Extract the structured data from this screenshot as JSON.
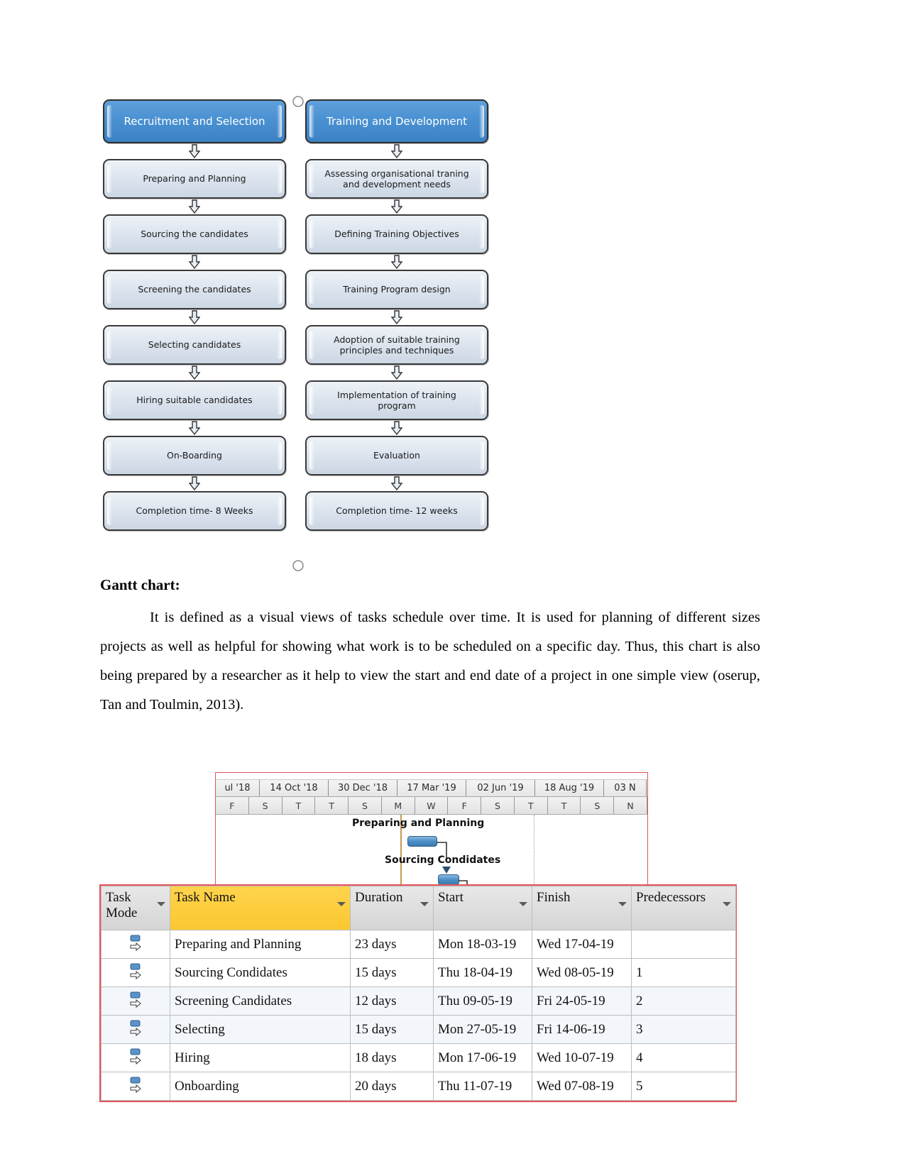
{
  "flowchart": {
    "columns": [
      {
        "header": "Recruitment and Selection",
        "steps": [
          "Preparing and Planning",
          "Sourcing the candidates",
          "Screening the candidates",
          "Selecting candidates",
          "Hiring  suitable candidates",
          "On-Boarding",
          "Completion time- 8 Weeks"
        ]
      },
      {
        "header": "Training and Development",
        "steps": [
          "Assessing organisational traning and development needs",
          "Defining Training Objectives",
          "Training Program design",
          "Adoption of suitable training principles and techniques",
          "Implementation of training program",
          "Evaluation",
          "Completion time- 12 weeks"
        ]
      }
    ],
    "colors": {
      "header_fill": "#4a91d2",
      "step_fill": "#dde5ef",
      "border": "#3a3a3a"
    }
  },
  "document": {
    "gantt_heading": "Gantt chart:",
    "intro_paragraph": "It is defined as a visual views of tasks schedule over time.  It is used for planning of different sizes projects as well as helpful for showing what work is to be scheduled on a specific day. Thus, this chart is also being prepared by a researcher as it help to view the start and end date of a project in one simple view (oserup, Tan and Toulmin, 2013)."
  },
  "chart_data": {
    "type": "bar",
    "title": "Gantt chart",
    "xlabel": "",
    "ylabel": "",
    "timeline": {
      "major_ticks": [
        "ul '18",
        "14 Oct '18",
        "30 Dec '18",
        "17 Mar '19",
        "02 Jun '19",
        "18 Aug '19",
        "03 N"
      ],
      "minor_ticks": [
        "F",
        "S",
        "T",
        "T",
        "S",
        "M",
        "W",
        "F",
        "S",
        "T",
        "T",
        "S",
        "N"
      ]
    },
    "bar_labels": [
      "Preparing and Planning",
      "Sourcing Condidates"
    ],
    "categories": [
      "Preparing and Planning",
      "Sourcing Condidates",
      "Screening Candidates",
      "Selecting",
      "Hiring",
      "Onboarding"
    ],
    "values": [
      23,
      15,
      12,
      15,
      18,
      20
    ],
    "series": [
      {
        "name": "Duration (days)",
        "values": [
          23,
          15,
          12,
          15,
          18,
          20
        ]
      }
    ],
    "starts": [
      "Mon 18-03-19",
      "Thu 18-04-19",
      "Thu 09-05-19",
      "Mon 27-05-19",
      "Mon 17-06-19",
      "Thu 11-07-19"
    ],
    "finishes": [
      "Wed 17-04-19",
      "Wed 08-05-19",
      "Fri 24-05-19",
      "Fri 14-06-19",
      "Wed 10-07-19",
      "Wed 07-08-19"
    ],
    "predecessors": [
      "",
      "1",
      "2",
      "3",
      "4",
      "5"
    ],
    "bar_color": "#4a8fc6",
    "grid": true,
    "legend": "none"
  },
  "task_table": {
    "headers": {
      "mode": "Task Mode",
      "name": "Task Name",
      "duration": "Duration",
      "start": "Start",
      "finish": "Finish",
      "predecessors": "Predecessors"
    },
    "rows": [
      {
        "name": "Preparing and Planning",
        "duration": "23 days",
        "start": "Mon 18-03-19",
        "finish": "Wed 17-04-19",
        "pred": ""
      },
      {
        "name": "Sourcing Condidates",
        "duration": "15 days",
        "start": "Thu 18-04-19",
        "finish": "Wed 08-05-19",
        "pred": "1"
      },
      {
        "name": "Screening Candidates",
        "duration": "12 days",
        "start": "Thu 09-05-19",
        "finish": "Fri 24-05-19",
        "pred": "2"
      },
      {
        "name": "Selecting",
        "duration": "15 days",
        "start": "Mon 27-05-19",
        "finish": "Fri 14-06-19",
        "pred": "3"
      },
      {
        "name": "Hiring",
        "duration": "18 days",
        "start": "Mon 17-06-19",
        "finish": "Wed 10-07-19",
        "pred": "4"
      },
      {
        "name": "Onboarding",
        "duration": "20 days",
        "start": "Thu 11-07-19",
        "finish": "Wed 07-08-19",
        "pred": "5"
      }
    ],
    "colors": {
      "name_header_fill": "#ffd34d",
      "header_fill": "#dedede",
      "frame": "#e4545b"
    }
  }
}
